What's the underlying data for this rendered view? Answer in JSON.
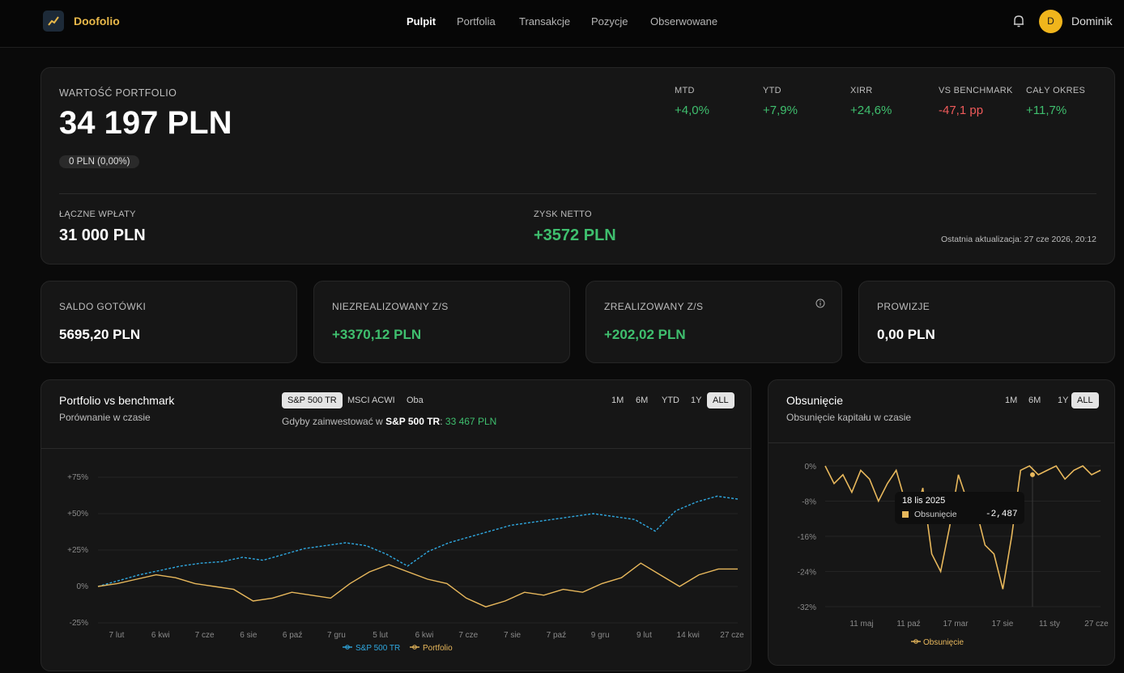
{
  "nav": {
    "brand": "Doofolio",
    "links": [
      "Pulpit",
      "Portfolia",
      "Transakcje",
      "Pozycje",
      "Obserwowane"
    ],
    "avatar_initial": "D",
    "username": "Dominik"
  },
  "summary": {
    "title": "WARTOŚĆ PORTFOLIO",
    "value": "34 197 PLN",
    "change_pill": "0 PLN (0,00%)",
    "metrics": [
      {
        "label": "MTD",
        "value": "+4,0%"
      },
      {
        "label": "YTD",
        "value": "+7,9%"
      },
      {
        "label": "XIRR",
        "value": "+24,6%"
      },
      {
        "label": "VS BENCHMARK",
        "value": "-47,1 pp"
      },
      {
        "label": "CAŁY OKRES",
        "value": "+11,7%"
      }
    ],
    "deposits_label": "ŁĄCZNE WPŁATY",
    "deposits_value": "31 000 PLN",
    "profit_label": "ZYSK NETTO",
    "profit_value": "+3572 PLN",
    "updated": "Ostatnia aktualizacja: 27 cze 2026, 20:12"
  },
  "stats": [
    {
      "label": "SALDO GOTÓWKI",
      "value": "5695,20 PLN"
    },
    {
      "label": "NIEZREALIZOWANY Z/S",
      "value": "+3370,12 PLN"
    },
    {
      "label": "ZREALIZOWANY Z/S",
      "value": "+202,02 PLN"
    },
    {
      "label": "PROWIZJE",
      "value": "0,00 PLN"
    }
  ],
  "benchmark": {
    "title": "Portfolio vs benchmark",
    "subtitle": "Porównanie w czasie",
    "bench_tabs": [
      "S&P 500 TR",
      "MSCI ACWI",
      "Oba"
    ],
    "range_tabs": [
      "1M",
      "6M",
      "YTD",
      "1Y",
      "ALL"
    ],
    "hypo_prefix": "Gdyby zainwestować w",
    "hypo_bench": "S&P 500 TR",
    "hypo_value": "33 467 PLN"
  },
  "drawdown": {
    "title": "Obsunięcie",
    "subtitle": "Obsunięcie kapitału w czasie",
    "range_tabs": [
      "1M",
      "6M",
      "1Y",
      "ALL"
    ],
    "tooltip_date": "18 lis 2025",
    "tooltip_label": "Obsunięcie",
    "tooltip_value": "-2,487"
  },
  "chart_data": [
    {
      "type": "line",
      "x_ticks": [
        "7 lut",
        "6 kwi",
        "7 cze",
        "6 sie",
        "6 paź",
        "7 gru",
        "5 lut",
        "6 kwi",
        "7 cze",
        "7 sie",
        "7 paź",
        "9 gru",
        "9 lut",
        "14 kwi",
        "27 cze"
      ],
      "y_ticks": [
        "+75%",
        "+50%",
        "+25%",
        "0%",
        "-25%"
      ],
      "ylim": [
        -25,
        75
      ],
      "series": [
        {
          "name": "S&P 500 TR",
          "color": "#2fa8e0",
          "style": "dashed",
          "values": [
            0,
            4,
            8,
            11,
            14,
            16,
            17,
            20,
            18,
            22,
            26,
            28,
            30,
            28,
            22,
            14,
            24,
            30,
            34,
            38,
            42,
            44,
            46,
            48,
            50,
            48,
            46,
            38,
            52,
            58,
            62,
            60
          ]
        },
        {
          "name": "Portfolio",
          "color": "#e8b85c",
          "style": "solid",
          "values": [
            0,
            2,
            5,
            8,
            6,
            2,
            0,
            -2,
            -10,
            -8,
            -4,
            -6,
            -8,
            2,
            10,
            15,
            10,
            5,
            2,
            -8,
            -14,
            -10,
            -4,
            -6,
            -2,
            -4,
            2,
            6,
            16,
            8,
            0,
            8,
            12,
            12
          ]
        }
      ]
    },
    {
      "type": "area",
      "x_ticks": [
        "11 maj",
        "11 paź",
        "17 mar",
        "17 sie",
        "11 sty",
        "27 cze"
      ],
      "y_ticks": [
        "0%",
        "-8%",
        "-16%",
        "-24%",
        "-32%"
      ],
      "ylim": [
        -32,
        0
      ],
      "series": [
        {
          "name": "Obsunięcie",
          "color": "#e8b85c",
          "values": [
            0,
            -4,
            -2,
            -6,
            -1,
            -3,
            -8,
            -4,
            -1,
            -8,
            -12,
            -5,
            -20,
            -24,
            -14,
            -2,
            -8,
            -10,
            -18,
            -20,
            -28,
            -16,
            -1,
            0,
            -2,
            -1,
            0,
            -3,
            -1,
            0,
            -2,
            -1
          ]
        }
      ]
    }
  ]
}
